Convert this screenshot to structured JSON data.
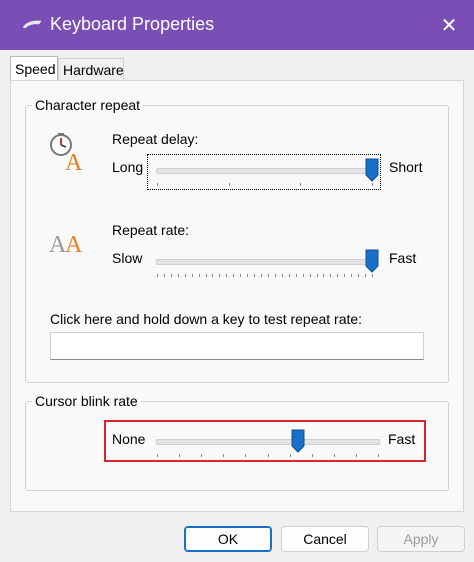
{
  "window": {
    "title": "Keyboard Properties",
    "close_glyph": "✕"
  },
  "tabs": [
    {
      "label": "Speed",
      "active": true
    },
    {
      "label": "Hardware",
      "active": false
    }
  ],
  "character_repeat": {
    "group_label": "Character repeat",
    "repeat_delay": {
      "label": "Repeat delay:",
      "min_label": "Long",
      "max_label": "Short",
      "value_fraction": 1.0,
      "tick_count": 4
    },
    "repeat_rate": {
      "label": "Repeat rate:",
      "min_label": "Slow",
      "max_label": "Fast",
      "value_fraction": 1.0,
      "tick_count": 32
    },
    "test_label": "Click here and hold down a key to test repeat rate:",
    "test_value": ""
  },
  "cursor_blink": {
    "group_label": "Cursor blink rate",
    "min_label": "None",
    "max_label": "Fast",
    "value_fraction": 0.64,
    "tick_count": 11
  },
  "buttons": {
    "ok": "OK",
    "cancel": "Cancel",
    "apply": "Apply"
  },
  "colors": {
    "titlebar": "#7a4fb5",
    "slider_thumb": "#1a6fc9",
    "highlight": "#d9262c"
  }
}
